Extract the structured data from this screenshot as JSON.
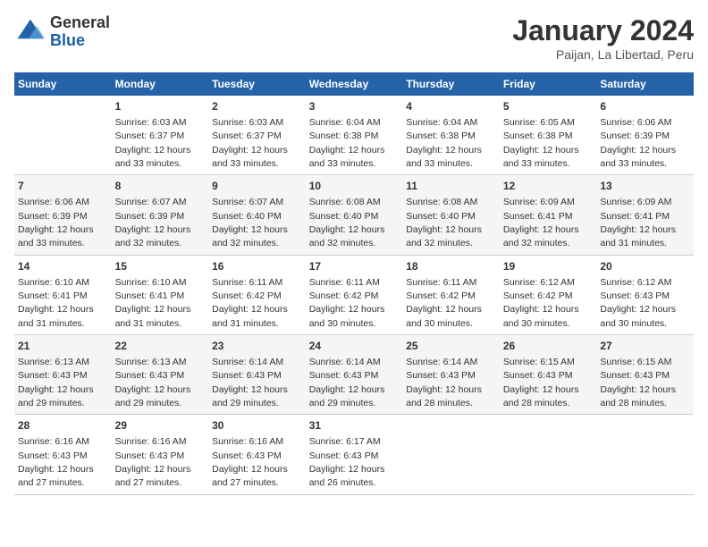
{
  "logo": {
    "general": "General",
    "blue": "Blue"
  },
  "header": {
    "title": "January 2024",
    "subtitle": "Paijan, La Libertad, Peru"
  },
  "weekdays": [
    "Sunday",
    "Monday",
    "Tuesday",
    "Wednesday",
    "Thursday",
    "Friday",
    "Saturday"
  ],
  "weeks": [
    [
      {
        "day": "",
        "sunrise": "",
        "sunset": "",
        "daylight": ""
      },
      {
        "day": "1",
        "sunrise": "Sunrise: 6:03 AM",
        "sunset": "Sunset: 6:37 PM",
        "daylight": "Daylight: 12 hours and 33 minutes."
      },
      {
        "day": "2",
        "sunrise": "Sunrise: 6:03 AM",
        "sunset": "Sunset: 6:37 PM",
        "daylight": "Daylight: 12 hours and 33 minutes."
      },
      {
        "day": "3",
        "sunrise": "Sunrise: 6:04 AM",
        "sunset": "Sunset: 6:38 PM",
        "daylight": "Daylight: 12 hours and 33 minutes."
      },
      {
        "day": "4",
        "sunrise": "Sunrise: 6:04 AM",
        "sunset": "Sunset: 6:38 PM",
        "daylight": "Daylight: 12 hours and 33 minutes."
      },
      {
        "day": "5",
        "sunrise": "Sunrise: 6:05 AM",
        "sunset": "Sunset: 6:38 PM",
        "daylight": "Daylight: 12 hours and 33 minutes."
      },
      {
        "day": "6",
        "sunrise": "Sunrise: 6:06 AM",
        "sunset": "Sunset: 6:39 PM",
        "daylight": "Daylight: 12 hours and 33 minutes."
      }
    ],
    [
      {
        "day": "7",
        "sunrise": "Sunrise: 6:06 AM",
        "sunset": "Sunset: 6:39 PM",
        "daylight": "Daylight: 12 hours and 33 minutes."
      },
      {
        "day": "8",
        "sunrise": "Sunrise: 6:07 AM",
        "sunset": "Sunset: 6:39 PM",
        "daylight": "Daylight: 12 hours and 32 minutes."
      },
      {
        "day": "9",
        "sunrise": "Sunrise: 6:07 AM",
        "sunset": "Sunset: 6:40 PM",
        "daylight": "Daylight: 12 hours and 32 minutes."
      },
      {
        "day": "10",
        "sunrise": "Sunrise: 6:08 AM",
        "sunset": "Sunset: 6:40 PM",
        "daylight": "Daylight: 12 hours and 32 minutes."
      },
      {
        "day": "11",
        "sunrise": "Sunrise: 6:08 AM",
        "sunset": "Sunset: 6:40 PM",
        "daylight": "Daylight: 12 hours and 32 minutes."
      },
      {
        "day": "12",
        "sunrise": "Sunrise: 6:09 AM",
        "sunset": "Sunset: 6:41 PM",
        "daylight": "Daylight: 12 hours and 32 minutes."
      },
      {
        "day": "13",
        "sunrise": "Sunrise: 6:09 AM",
        "sunset": "Sunset: 6:41 PM",
        "daylight": "Daylight: 12 hours and 31 minutes."
      }
    ],
    [
      {
        "day": "14",
        "sunrise": "Sunrise: 6:10 AM",
        "sunset": "Sunset: 6:41 PM",
        "daylight": "Daylight: 12 hours and 31 minutes."
      },
      {
        "day": "15",
        "sunrise": "Sunrise: 6:10 AM",
        "sunset": "Sunset: 6:41 PM",
        "daylight": "Daylight: 12 hours and 31 minutes."
      },
      {
        "day": "16",
        "sunrise": "Sunrise: 6:11 AM",
        "sunset": "Sunset: 6:42 PM",
        "daylight": "Daylight: 12 hours and 31 minutes."
      },
      {
        "day": "17",
        "sunrise": "Sunrise: 6:11 AM",
        "sunset": "Sunset: 6:42 PM",
        "daylight": "Daylight: 12 hours and 30 minutes."
      },
      {
        "day": "18",
        "sunrise": "Sunrise: 6:11 AM",
        "sunset": "Sunset: 6:42 PM",
        "daylight": "Daylight: 12 hours and 30 minutes."
      },
      {
        "day": "19",
        "sunrise": "Sunrise: 6:12 AM",
        "sunset": "Sunset: 6:42 PM",
        "daylight": "Daylight: 12 hours and 30 minutes."
      },
      {
        "day": "20",
        "sunrise": "Sunrise: 6:12 AM",
        "sunset": "Sunset: 6:43 PM",
        "daylight": "Daylight: 12 hours and 30 minutes."
      }
    ],
    [
      {
        "day": "21",
        "sunrise": "Sunrise: 6:13 AM",
        "sunset": "Sunset: 6:43 PM",
        "daylight": "Daylight: 12 hours and 29 minutes."
      },
      {
        "day": "22",
        "sunrise": "Sunrise: 6:13 AM",
        "sunset": "Sunset: 6:43 PM",
        "daylight": "Daylight: 12 hours and 29 minutes."
      },
      {
        "day": "23",
        "sunrise": "Sunrise: 6:14 AM",
        "sunset": "Sunset: 6:43 PM",
        "daylight": "Daylight: 12 hours and 29 minutes."
      },
      {
        "day": "24",
        "sunrise": "Sunrise: 6:14 AM",
        "sunset": "Sunset: 6:43 PM",
        "daylight": "Daylight: 12 hours and 29 minutes."
      },
      {
        "day": "25",
        "sunrise": "Sunrise: 6:14 AM",
        "sunset": "Sunset: 6:43 PM",
        "daylight": "Daylight: 12 hours and 28 minutes."
      },
      {
        "day": "26",
        "sunrise": "Sunrise: 6:15 AM",
        "sunset": "Sunset: 6:43 PM",
        "daylight": "Daylight: 12 hours and 28 minutes."
      },
      {
        "day": "27",
        "sunrise": "Sunrise: 6:15 AM",
        "sunset": "Sunset: 6:43 PM",
        "daylight": "Daylight: 12 hours and 28 minutes."
      }
    ],
    [
      {
        "day": "28",
        "sunrise": "Sunrise: 6:16 AM",
        "sunset": "Sunset: 6:43 PM",
        "daylight": "Daylight: 12 hours and 27 minutes."
      },
      {
        "day": "29",
        "sunrise": "Sunrise: 6:16 AM",
        "sunset": "Sunset: 6:43 PM",
        "daylight": "Daylight: 12 hours and 27 minutes."
      },
      {
        "day": "30",
        "sunrise": "Sunrise: 6:16 AM",
        "sunset": "Sunset: 6:43 PM",
        "daylight": "Daylight: 12 hours and 27 minutes."
      },
      {
        "day": "31",
        "sunrise": "Sunrise: 6:17 AM",
        "sunset": "Sunset: 6:43 PM",
        "daylight": "Daylight: 12 hours and 26 minutes."
      },
      {
        "day": "",
        "sunrise": "",
        "sunset": "",
        "daylight": ""
      },
      {
        "day": "",
        "sunrise": "",
        "sunset": "",
        "daylight": ""
      },
      {
        "day": "",
        "sunrise": "",
        "sunset": "",
        "daylight": ""
      }
    ]
  ]
}
